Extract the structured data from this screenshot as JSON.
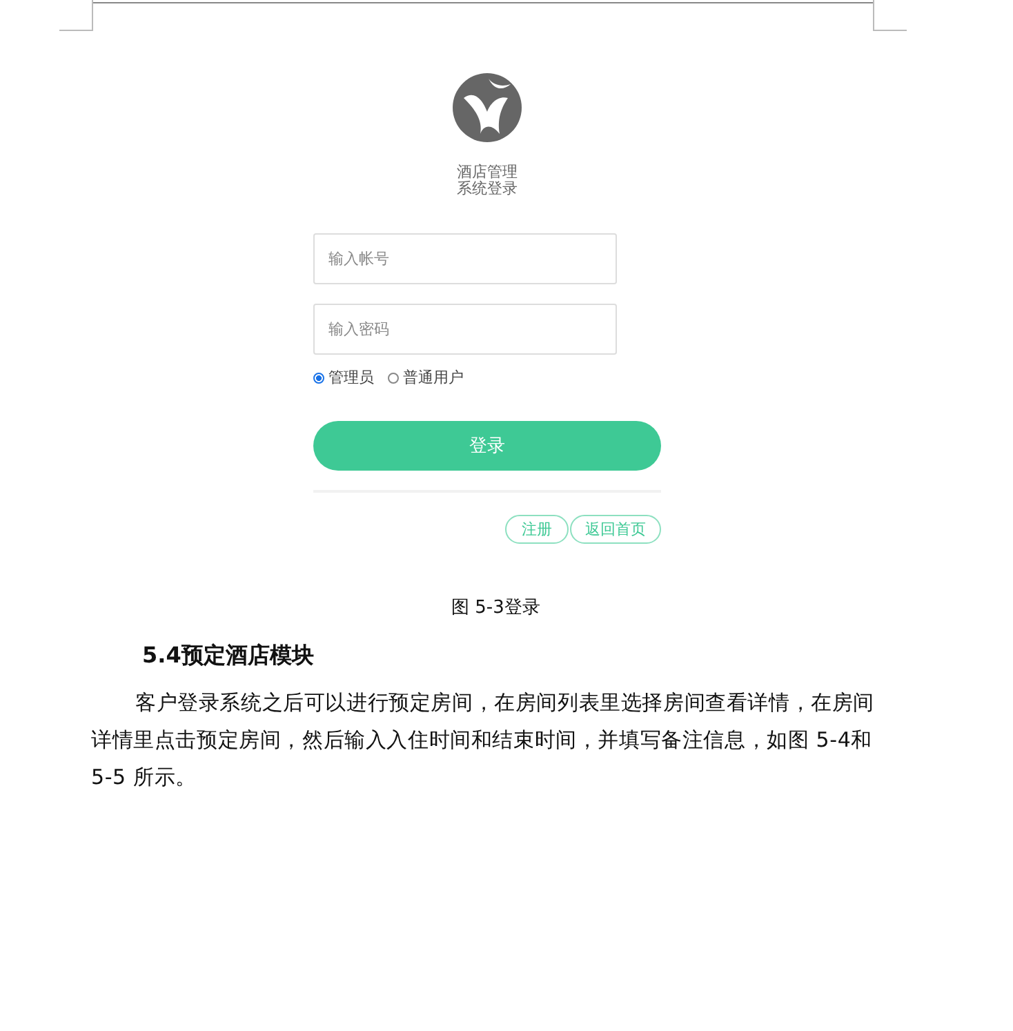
{
  "login_screenshot": {
    "title_lines": [
      "酒店管理",
      "系统登录"
    ],
    "fields": [
      {
        "placeholder": "输入帐号"
      },
      {
        "placeholder": "输入密码"
      }
    ],
    "roles": [
      {
        "label": "管理员",
        "selected": true
      },
      {
        "label": "普通用户",
        "selected": false
      }
    ],
    "login_button": "登录",
    "links": [
      "注册",
      "返回首页"
    ]
  },
  "caption": "图 5-3登录",
  "heading": "5.4预定酒店模块",
  "paragraph": "客户登录系统之后可以进行预定房间，在房间列表里选择房间查看详情，在房间详情里点击预定房间，然后输入入住时间和结束时间，并填写备注信息，如图 5-4和 5-5 所示。"
}
